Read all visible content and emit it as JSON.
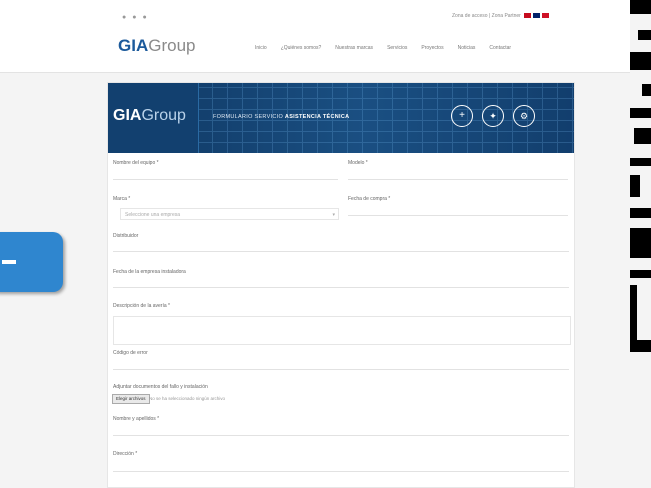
{
  "header": {
    "social_icons": [
      "twitter-icon",
      "facebook-icon",
      "linkedin-icon"
    ],
    "top_links": "Zona de acceso | Zona Partner",
    "logo_bold": "GIA",
    "logo_light": "Group",
    "nav": [
      "Inicio",
      "¿Quiénes somos?",
      "Nuestras marcas",
      "Servicios",
      "Proyectos",
      "Noticias",
      "Contactar"
    ]
  },
  "form": {
    "banner_brand_bold": "GIA",
    "banner_brand_light": "Group",
    "banner_title_1": "FORMULARIO SERVICIO",
    "banner_title_2": "ASISTENCIA TÉCNICA",
    "banner_icons": [
      "plus-icon",
      "lightbulb-icon",
      "tools-icon"
    ],
    "fields": {
      "nombre_equipo": "Nombre del equipo *",
      "modelo": "Modelo *",
      "marca": "Marca *",
      "marca_placeholder": "Seleccione una empresa",
      "fecha_compra": "Fecha de compra *",
      "distribuidor": "Distribuidor",
      "fecha_instalacion": "Fecha de la empresa instaladora",
      "descripcion": "Descripción de la avería *",
      "codigo_error": "Código de error",
      "adjuntar": "Adjuntar documentos del fallo y instalación",
      "file_button": "Elegir archivos",
      "file_status": "No se ha seleccionado ningún archivo",
      "nombre_apellidos": "Nombre y apellidos *",
      "direccion": "Dirección *"
    }
  },
  "colors": {
    "brand_blue": "#1c5a9b",
    "banner_dark": "#0f3762",
    "side_tab": "#2f86cf"
  }
}
